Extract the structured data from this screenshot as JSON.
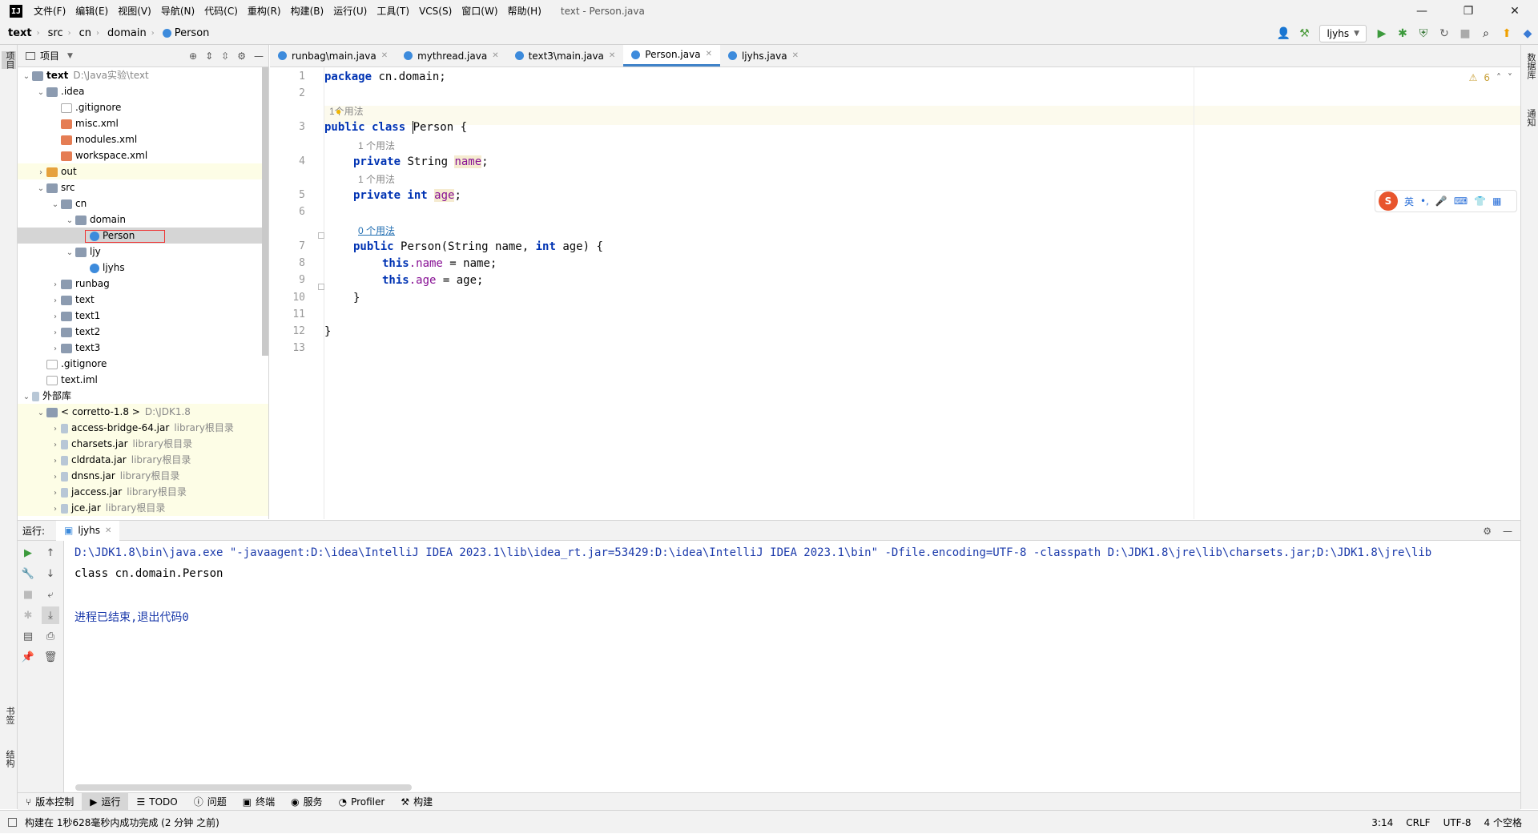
{
  "app": {
    "logo": "IJ",
    "window_title": "text - Person.java"
  },
  "menu": [
    "文件(F)",
    "编辑(E)",
    "视图(V)",
    "导航(N)",
    "代码(C)",
    "重构(R)",
    "构建(B)",
    "运行(U)",
    "工具(T)",
    "VCS(S)",
    "窗口(W)",
    "帮助(H)"
  ],
  "breadcrumb": [
    "text",
    "src",
    "cn",
    "domain",
    "Person"
  ],
  "run_config": "ljyhs",
  "left_stripe": {
    "top": "项目",
    "bookmarks": "书签",
    "structure": "结构"
  },
  "right_stripe": {
    "database": "数据库",
    "notifications": "通知"
  },
  "project": {
    "title": "项目",
    "tree": [
      {
        "label": "text",
        "hint": "D:\\Java实验\\text",
        "indent": 0,
        "arrow": "v",
        "icon": "folder",
        "bold": true
      },
      {
        "label": ".idea",
        "indent": 1,
        "arrow": "v",
        "icon": "folder"
      },
      {
        "label": ".gitignore",
        "indent": 2,
        "icon": "file"
      },
      {
        "label": "misc.xml",
        "indent": 2,
        "icon": "xml"
      },
      {
        "label": "modules.xml",
        "indent": 2,
        "icon": "xml"
      },
      {
        "label": "workspace.xml",
        "indent": 2,
        "icon": "xml"
      },
      {
        "label": "out",
        "indent": 1,
        "arrow": ">",
        "icon": "folder-o",
        "yel": true
      },
      {
        "label": "src",
        "indent": 1,
        "arrow": "v",
        "icon": "folder"
      },
      {
        "label": "cn",
        "indent": 2,
        "arrow": "v",
        "icon": "folder"
      },
      {
        "label": "domain",
        "indent": 3,
        "arrow": "v",
        "icon": "folder"
      },
      {
        "label": "Person",
        "indent": 4,
        "icon": "cls",
        "sel": true
      },
      {
        "label": "ljy",
        "indent": 3,
        "arrow": "v",
        "icon": "folder"
      },
      {
        "label": "ljyhs",
        "indent": 4,
        "icon": "cls"
      },
      {
        "label": "runbag",
        "indent": 2,
        "arrow": ">",
        "icon": "folder"
      },
      {
        "label": "text",
        "indent": 2,
        "arrow": ">",
        "icon": "folder"
      },
      {
        "label": "text1",
        "indent": 2,
        "arrow": ">",
        "icon": "folder"
      },
      {
        "label": "text2",
        "indent": 2,
        "arrow": ">",
        "icon": "folder"
      },
      {
        "label": "text3",
        "indent": 2,
        "arrow": ">",
        "icon": "folder"
      },
      {
        "label": ".gitignore",
        "indent": 1,
        "icon": "file"
      },
      {
        "label": "text.iml",
        "indent": 1,
        "icon": "file"
      },
      {
        "label": "外部库",
        "indent": 0,
        "arrow": "v",
        "icon": "jar"
      },
      {
        "label": "< corretto-1.8 >",
        "hint": "D:\\JDK1.8",
        "indent": 1,
        "arrow": "v",
        "icon": "folder",
        "yel": true
      },
      {
        "label": "access-bridge-64.jar",
        "hint": "library根目录",
        "indent": 2,
        "arrow": ">",
        "icon": "jar",
        "yel": true
      },
      {
        "label": "charsets.jar",
        "hint": "library根目录",
        "indent": 2,
        "arrow": ">",
        "icon": "jar",
        "yel": true
      },
      {
        "label": "cldrdata.jar",
        "hint": "library根目录",
        "indent": 2,
        "arrow": ">",
        "icon": "jar",
        "yel": true
      },
      {
        "label": "dnsns.jar",
        "hint": "library根目录",
        "indent": 2,
        "arrow": ">",
        "icon": "jar",
        "yel": true
      },
      {
        "label": "jaccess.jar",
        "hint": "library根目录",
        "indent": 2,
        "arrow": ">",
        "icon": "jar",
        "yel": true
      },
      {
        "label": "jce.jar",
        "hint": "library根目录",
        "indent": 2,
        "arrow": ">",
        "icon": "jar",
        "yel": true
      }
    ]
  },
  "tabs": [
    {
      "label": "runbag\\main.java",
      "active": false
    },
    {
      "label": "mythread.java",
      "active": false
    },
    {
      "label": "text3\\main.java",
      "active": false
    },
    {
      "label": "Person.java",
      "active": true
    },
    {
      "label": "ljyhs.java",
      "active": false
    }
  ],
  "editor": {
    "warnings": "6",
    "line_numbers": [
      "1",
      "2",
      "3",
      "4",
      "5",
      "6",
      "7",
      "8",
      "9",
      "10",
      "11",
      "12",
      "13"
    ],
    "hints": {
      "h1": "1个用法",
      "h2": "1 个用法",
      "h3": "1 个用法",
      "h4": "0 个用法"
    },
    "code": {
      "l1_kw": "package",
      "l1_rest": " cn.domain;",
      "l3_kw": "public class ",
      "l3_name": "Person",
      "l3_rest": " {",
      "l4_kw": "private ",
      "l4_type": "String ",
      "l4_var": "name",
      "l4_end": ";",
      "l5_kw": "private int ",
      "l5_var": "age",
      "l5_end": ";",
      "l7_kw": "public ",
      "l7_sig1": "Person(String name, ",
      "l7_int": "int",
      "l7_sig2": " age) {",
      "l8_kw": "this",
      "l8_fld": ".name",
      "l8_rest": " = name;",
      "l9_kw": "this",
      "l9_fld": ".age",
      "l9_rest": " = age;",
      "l10": "}",
      "l12": "}"
    }
  },
  "ime": {
    "lang": "英",
    "punct": "•,"
  },
  "run": {
    "label": "运行:",
    "tab": "ljyhs",
    "output": [
      "D:\\JDK1.8\\bin\\java.exe \"-javaagent:D:\\idea\\IntelliJ IDEA 2023.1\\lib\\idea_rt.jar=53429:D:\\idea\\IntelliJ IDEA 2023.1\\bin\" -Dfile.encoding=UTF-8 -classpath D:\\JDK1.8\\jre\\lib\\charsets.jar;D:\\JDK1.8\\jre\\lib",
      "class cn.domain.Person",
      "",
      "进程已结束,退出代码0"
    ]
  },
  "bottom_tools": [
    "版本控制",
    "运行",
    "TODO",
    "问题",
    "终端",
    "服务",
    "Profiler",
    "构建"
  ],
  "status": {
    "message": "构建在 1秒628毫秒内成功完成 (2 分钟 之前)",
    "position": "3:14",
    "line_sep": "CRLF",
    "encoding": "UTF-8",
    "indent": "4 个空格"
  },
  "colors": {
    "accent": "#4083c9",
    "keyword": "#0033b3",
    "field": "#871094",
    "selection_box": "#e33333"
  }
}
